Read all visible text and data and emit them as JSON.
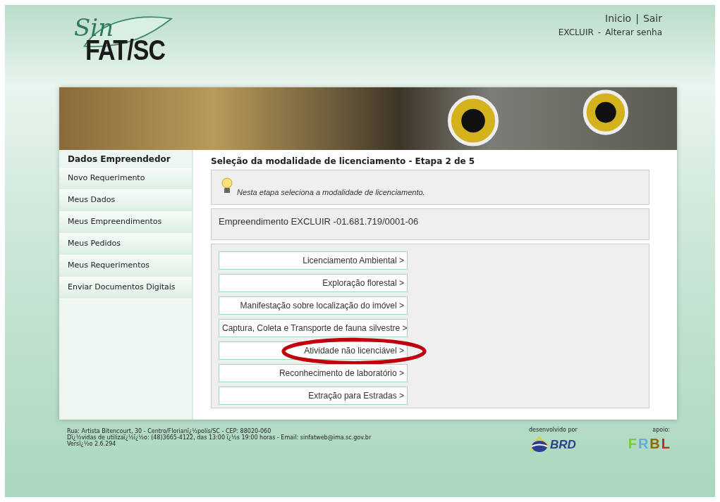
{
  "header": {
    "logo": {
      "script": "Sin",
      "title": "FAT/SC"
    },
    "links": [
      {
        "label": "Inicio"
      },
      {
        "label": "Sair"
      }
    ],
    "separator": "|",
    "user": "EXCLUIR",
    "user_separator": "-",
    "account_link": "Alterar senha"
  },
  "sidebar": {
    "title": "Dados Empreendedor",
    "items": [
      {
        "label": "Novo Requerimento"
      },
      {
        "label": "Meus Dados"
      },
      {
        "label": "Meus Empreendimentos"
      },
      {
        "label": "Meus Pedidos"
      },
      {
        "label": "Meus Requerimentos"
      },
      {
        "label": "Enviar Documentos Digitais"
      }
    ]
  },
  "content": {
    "title": "Seleção da modalidade de licenciamento - Etapa 2 de 5",
    "hint": "Nesta etapa seleciona a modalidade de licenciamento.",
    "enterprise": "Empreendimento EXCLUIR -01.681.719/0001-06",
    "options": [
      {
        "label": "Licenciamento Ambiental >",
        "highlighted": false
      },
      {
        "label": "Exploração florestal >",
        "highlighted": false
      },
      {
        "label": "Manifestação sobre localização do imóvel >",
        "highlighted": false
      },
      {
        "label": "Captura, Coleta e Transporte de fauna silvestre >",
        "highlighted": false
      },
      {
        "label": "Atividade não licenciável >",
        "highlighted": true
      },
      {
        "label": "Reconhecimento de laboratório >",
        "highlighted": false
      },
      {
        "label": "Extração para Estradas >",
        "highlighted": false
      }
    ]
  },
  "footer": {
    "lines": [
      "Rua: Artista Bitencourt, 30 - Centro/Florianï¿½polis/SC - CEP: 88020-060",
      "Dï¿½vidas de utilizaï¿½ï¿½o: (48)3665-4122, das 13:00 ï¿½s 19:00 horas - Email: sinfatweb@ima.sc.gov.br",
      "Versï¿½o 2.6.294"
    ],
    "developed_by": "desenvolvido por",
    "developer_logo": "BRD",
    "support": "apoio:",
    "support_logo": [
      "F",
      "R",
      "B",
      "L"
    ]
  }
}
